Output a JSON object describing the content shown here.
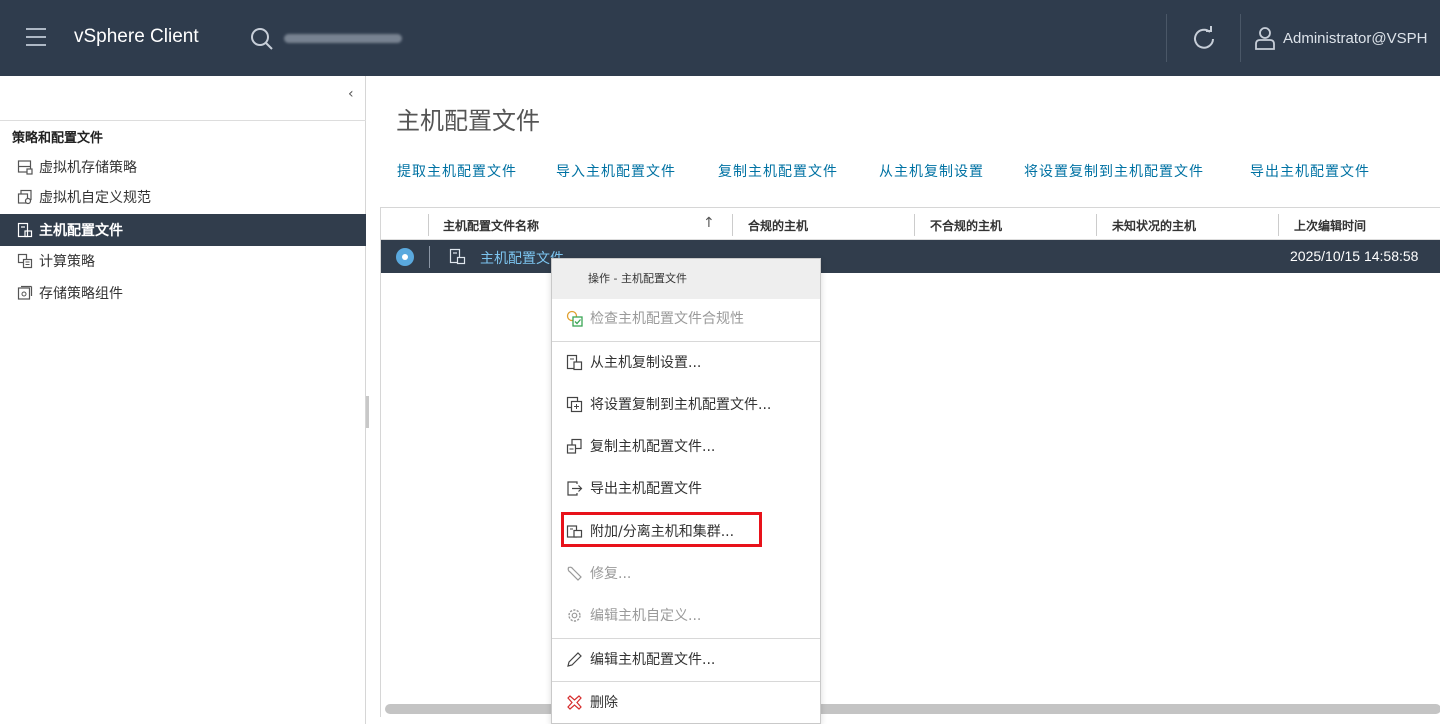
{
  "header": {
    "app_title": "vSphere Client",
    "user": "Administrator@VSPH",
    "icons": [
      "hamburger-icon",
      "search-icon",
      "refresh-icon",
      "user-icon"
    ]
  },
  "sidebar": {
    "section_title": "策略和配置文件",
    "items": [
      {
        "label": "虚拟机存储策略",
        "icon": "storage-policy-icon",
        "active": false
      },
      {
        "label": "虚拟机自定义规范",
        "icon": "vm-customization-icon",
        "active": false
      },
      {
        "label": "主机配置文件",
        "icon": "host-profile-icon",
        "active": true
      },
      {
        "label": "计算策略",
        "icon": "compute-policy-icon",
        "active": false
      },
      {
        "label": "存储策略组件",
        "icon": "storage-component-icon",
        "active": false
      }
    ]
  },
  "main": {
    "title": "主机配置文件",
    "actions": [
      "提取主机配置文件",
      "导入主机配置文件",
      "复制主机配置文件",
      "从主机复制设置",
      "将设置复制到主机配置文件",
      "导出主机配置文件"
    ],
    "table": {
      "columns": [
        "主机配置文件名称",
        "合规的主机",
        "不合规的主机",
        "未知状况的主机",
        "上次编辑时间"
      ],
      "sort_indicator": "↑",
      "rows": [
        {
          "name": "主机配置文件",
          "compliant": "",
          "noncompliant": "",
          "unknown": "",
          "last_edited": "2025/10/15 14:58:58"
        }
      ]
    }
  },
  "context_menu": {
    "title": "操作 - 主机配置文件",
    "items": [
      {
        "label": "检查主机配置文件合规性",
        "icon": "check-compliance-icon",
        "disabled": true
      },
      {
        "label": "从主机复制设置...",
        "icon": "copy-from-host-icon",
        "disabled": false
      },
      {
        "label": "将设置复制到主机配置文件...",
        "icon": "copy-to-profile-icon",
        "disabled": false
      },
      {
        "label": "复制主机配置文件...",
        "icon": "duplicate-profile-icon",
        "disabled": false
      },
      {
        "label": "导出主机配置文件",
        "icon": "export-icon",
        "disabled": false
      },
      {
        "label": "附加/分离主机和集群...",
        "icon": "attach-detach-icon",
        "disabled": false
      },
      {
        "label": "修复...",
        "icon": "wrench-icon",
        "disabled": true
      },
      {
        "label": "编辑主机自定义...",
        "icon": "gear-icon",
        "disabled": true
      },
      {
        "label": "编辑主机配置文件...",
        "icon": "pencil-icon",
        "disabled": false
      },
      {
        "label": "删除",
        "icon": "delete-icon",
        "disabled": false
      }
    ]
  },
  "colors": {
    "header_bg": "#2f3c4d",
    "selected_bg": "#313d4c",
    "link": "#0072a3",
    "highlight_border": "#e8121a"
  }
}
